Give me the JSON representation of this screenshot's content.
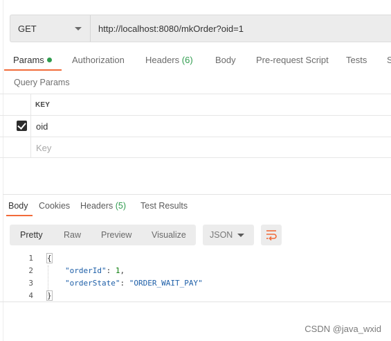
{
  "request": {
    "method": "GET",
    "url": "http://localhost:8080/mkOrder?oid=1"
  },
  "request_tabs": {
    "params": "Params",
    "authorization": "Authorization",
    "headers": "Headers",
    "headers_count": "(6)",
    "body": "Body",
    "prerequest": "Pre-request Script",
    "tests": "Tests",
    "overflow": "S"
  },
  "query_params": {
    "title": "Query Params",
    "column_key": "KEY",
    "rows": [
      {
        "key": "oid",
        "checked": true
      }
    ],
    "new_key_placeholder": "Key"
  },
  "response_tabs": {
    "body": "Body",
    "cookies": "Cookies",
    "headers": "Headers",
    "headers_count": "(5)",
    "test_results": "Test Results"
  },
  "response_view": {
    "pretty": "Pretty",
    "raw": "Raw",
    "preview": "Preview",
    "visualize": "Visualize",
    "format": "JSON"
  },
  "response_body": {
    "line_numbers": [
      "1",
      "2",
      "3",
      "4"
    ],
    "open_brace": "{",
    "close_brace": "}",
    "order_id_key": "\"orderId\"",
    "order_id_value": "1",
    "order_state_key": "\"orderState\"",
    "order_state_value": "\"ORDER_WAIT_PAY\""
  },
  "watermark": "CSDN @java_wxid",
  "colors": {
    "accent": "#f26b3a",
    "count_green": "#2f9c4e",
    "json_key": "#1e5fa8",
    "json_number": "#0a7d0a"
  }
}
